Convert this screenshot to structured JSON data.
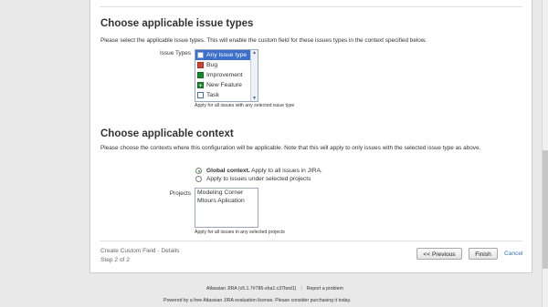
{
  "issue_types_section": {
    "title": "Choose applicable issue types",
    "description": "Please select the applicable issue types. This will enable the custom field for these issues types in the context specified below.",
    "field_label": "Issue Types",
    "options": [
      {
        "label": "Any issue type",
        "icon": "any-issue-type-icon",
        "selected": true
      },
      {
        "label": "Bug",
        "icon": "bug-icon",
        "selected": false
      },
      {
        "label": "Improvement",
        "icon": "improvement-icon",
        "selected": false
      },
      {
        "label": "New Feature",
        "icon": "new-feature-icon",
        "selected": false
      },
      {
        "label": "Task",
        "icon": "task-icon",
        "selected": false
      }
    ],
    "help": "Apply for all issues with any selected issue type"
  },
  "context_section": {
    "title": "Choose applicable context",
    "description": "Please choose the contexts where this configuration will be applicable. Note that this will apply to only issues with the selected issue type as above.",
    "radio_global_bold": "Global context.",
    "radio_global_rest": " Apply to all issues in JIRA.",
    "radio_selected": "Apply to issues under selected projects",
    "global_selected": true,
    "projects_label": "Projects",
    "projects": [
      "Modeling Corner",
      "Mtours Aplication"
    ],
    "projects_help": "Apply for all issues in any selected projects"
  },
  "footer": {
    "step_title": "Create Custom Field - Details",
    "step_count": "Step 2 of 2",
    "previous_label": "<< Previous",
    "finish_label": "Finish",
    "cancel_label": "Cancel"
  },
  "page_footer": {
    "version": "Atlassian JIRA (v5.1.7#786-sha1:c37bed1)",
    "separator": "|",
    "report": "Report a problem",
    "license": "Powered by a free Atlassian JIRA evaluation license. Please consider purchasing it today."
  },
  "colors": {
    "link": "#3b73af",
    "selected": "#3b6fc9"
  }
}
